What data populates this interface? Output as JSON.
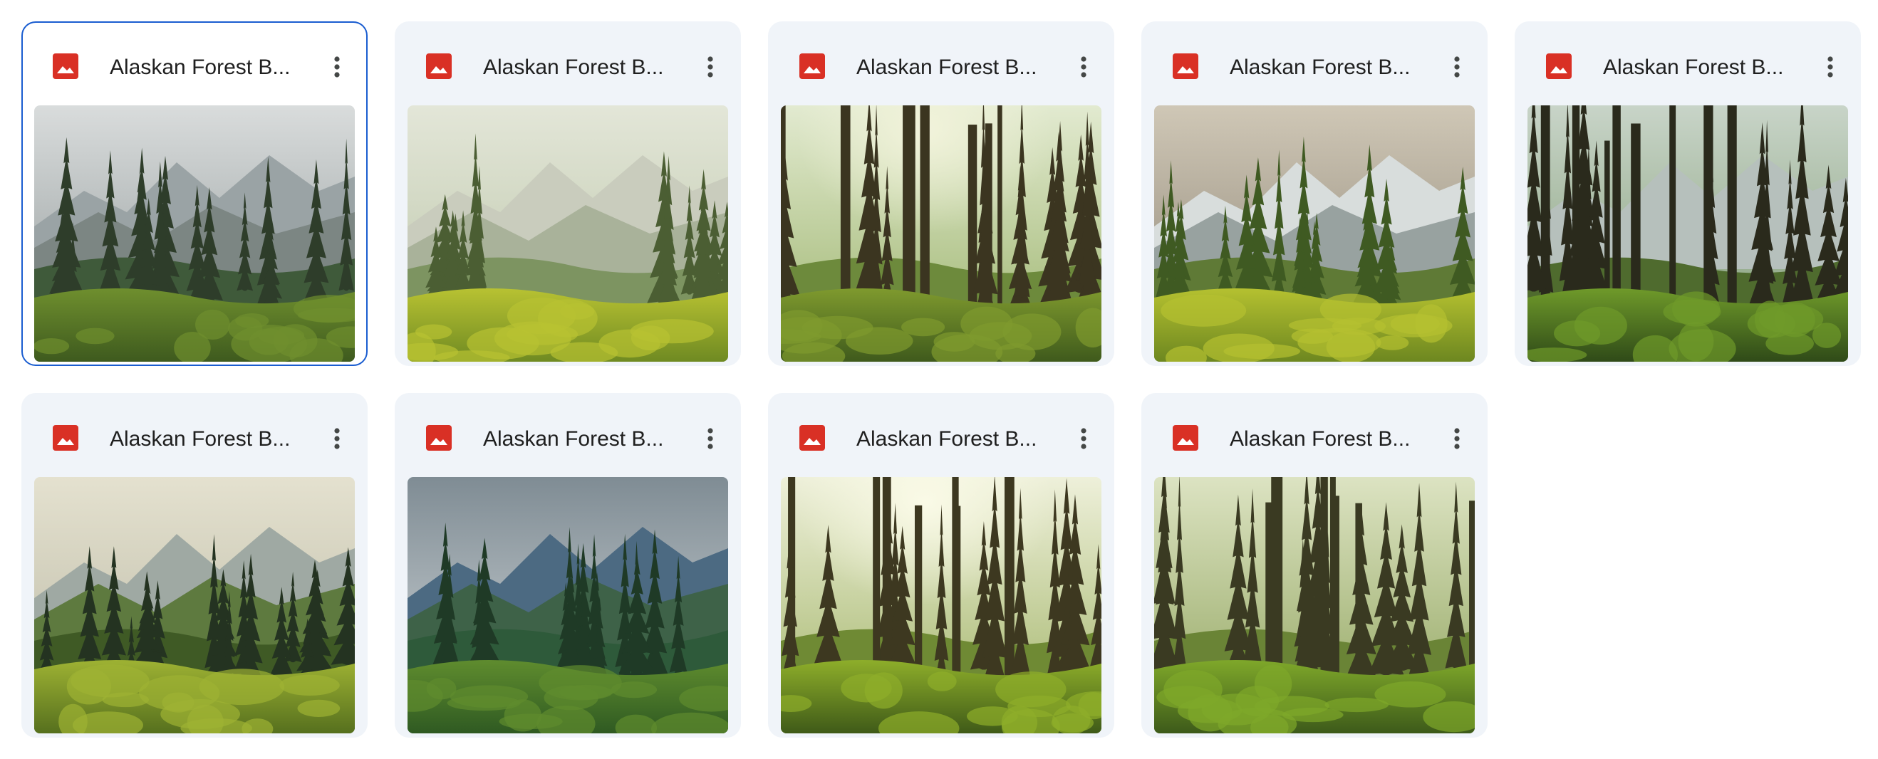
{
  "files": [
    {
      "name": "Alaskan Forest B...",
      "icon": "image-file-icon",
      "selected": true,
      "scene": "mountain-mist"
    },
    {
      "name": "Alaskan Forest B...",
      "icon": "image-file-icon",
      "selected": false,
      "scene": "misty-meadow"
    },
    {
      "name": "Alaskan Forest B...",
      "icon": "image-file-icon",
      "selected": false,
      "scene": "deep-forest"
    },
    {
      "name": "Alaskan Forest B...",
      "icon": "image-file-icon",
      "selected": false,
      "scene": "valley-peaks"
    },
    {
      "name": "Alaskan Forest B...",
      "icon": "image-file-icon",
      "selected": false,
      "scene": "fern-trail"
    },
    {
      "name": "Alaskan Forest B...",
      "icon": "image-file-icon",
      "selected": false,
      "scene": "green-valley"
    },
    {
      "name": "Alaskan Forest B...",
      "icon": "image-file-icon",
      "selected": false,
      "scene": "blue-valley"
    },
    {
      "name": "Alaskan Forest B...",
      "icon": "image-file-icon",
      "selected": false,
      "scene": "mossy-creek"
    },
    {
      "name": "Alaskan Forest B...",
      "icon": "image-file-icon",
      "selected": false,
      "scene": "sunlit-forest"
    }
  ],
  "colors": {
    "accent": "#1a5dd0",
    "card_bg": "#f0f4f9",
    "image_icon": "#d93025",
    "title_text": "#1f1f1f"
  }
}
